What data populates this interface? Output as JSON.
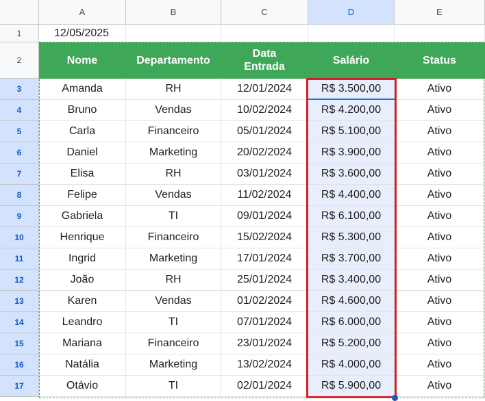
{
  "columns": [
    "A",
    "B",
    "C",
    "D",
    "E"
  ],
  "selected_column": "D",
  "date_cell": "12/05/2025",
  "header": {
    "nome": "Nome",
    "departamento": "Departamento",
    "data_entrada": "Data\nEntrada",
    "salario": "Salário",
    "status": "Status"
  },
  "rows": [
    {
      "n": "3",
      "nome": "Amanda",
      "dep": "RH",
      "data": "12/01/2024",
      "sal": "R$ 3.500,00",
      "status": "Ativo"
    },
    {
      "n": "4",
      "nome": "Bruno",
      "dep": "Vendas",
      "data": "10/02/2024",
      "sal": "R$ 4.200,00",
      "status": "Ativo"
    },
    {
      "n": "5",
      "nome": "Carla",
      "dep": "Financeiro",
      "data": "05/01/2024",
      "sal": "R$ 5.100,00",
      "status": "Ativo"
    },
    {
      "n": "6",
      "nome": "Daniel",
      "dep": "Marketing",
      "data": "20/02/2024",
      "sal": "R$ 3.900,00",
      "status": "Ativo"
    },
    {
      "n": "7",
      "nome": "Elisa",
      "dep": "RH",
      "data": "03/01/2024",
      "sal": "R$ 3.600,00",
      "status": "Ativo"
    },
    {
      "n": "8",
      "nome": "Felipe",
      "dep": "Vendas",
      "data": "11/02/2024",
      "sal": "R$ 4.400,00",
      "status": "Ativo"
    },
    {
      "n": "9",
      "nome": "Gabriela",
      "dep": "TI",
      "data": "09/01/2024",
      "sal": "R$ 6.100,00",
      "status": "Ativo"
    },
    {
      "n": "10",
      "nome": "Henrique",
      "dep": "Financeiro",
      "data": "15/02/2024",
      "sal": "R$ 5.300,00",
      "status": "Ativo"
    },
    {
      "n": "11",
      "nome": "Ingrid",
      "dep": "Marketing",
      "data": "17/01/2024",
      "sal": "R$ 3.700,00",
      "status": "Ativo"
    },
    {
      "n": "12",
      "nome": "João",
      "dep": "RH",
      "data": "25/01/2024",
      "sal": "R$ 3.400,00",
      "status": "Ativo"
    },
    {
      "n": "13",
      "nome": "Karen",
      "dep": "Vendas",
      "data": "01/02/2024",
      "sal": "R$ 4.600,00",
      "status": "Ativo"
    },
    {
      "n": "14",
      "nome": "Leandro",
      "dep": "TI",
      "data": "07/01/2024",
      "sal": "R$ 6.000,00",
      "status": "Ativo"
    },
    {
      "n": "15",
      "nome": "Mariana",
      "dep": "Financeiro",
      "data": "23/01/2024",
      "sal": "R$ 5.200,00",
      "status": "Ativo"
    },
    {
      "n": "16",
      "nome": "Natália",
      "dep": "Marketing",
      "data": "13/02/2024",
      "sal": "R$ 4.000,00",
      "status": "Ativo"
    },
    {
      "n": "17",
      "nome": "Otávio",
      "dep": "TI",
      "data": "02/01/2024",
      "sal": "R$ 5.900,00",
      "status": "Ativo"
    }
  ],
  "colors": {
    "header_green": "#3ea758",
    "selection_red": "#d32026",
    "selected_fill": "#e8eefb"
  }
}
